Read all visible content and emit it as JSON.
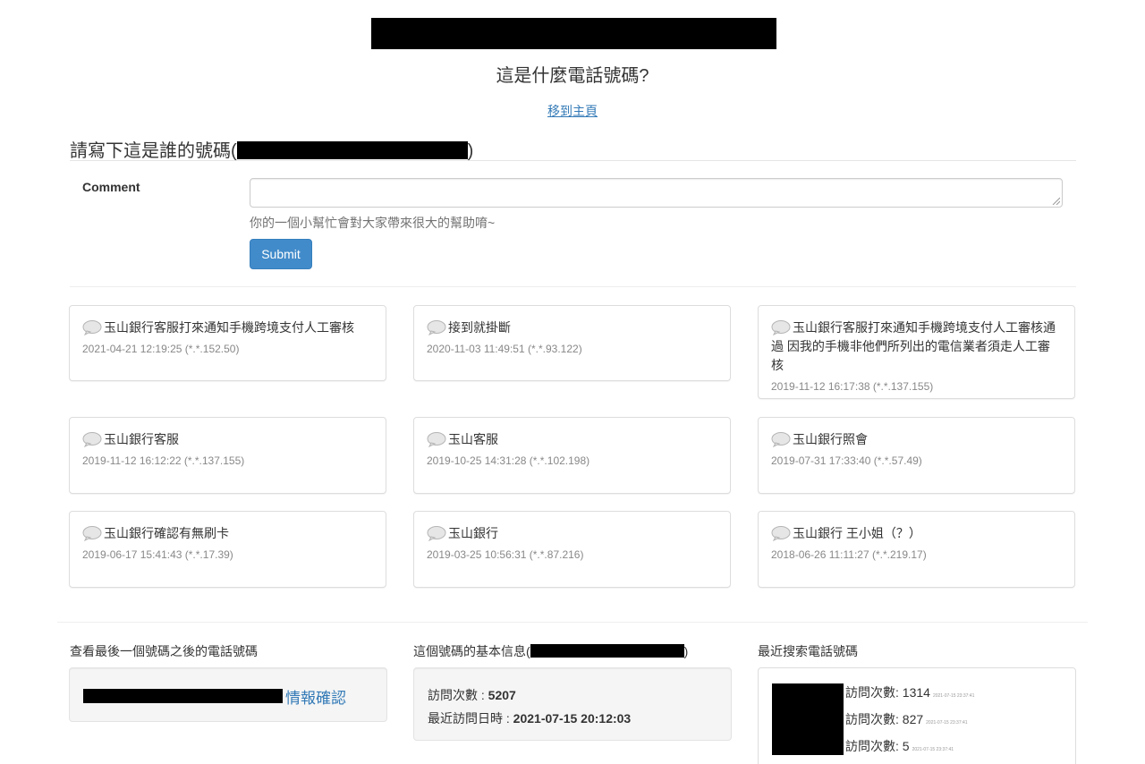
{
  "header": {
    "title": "這是什麼電話號碼?",
    "home_link": "移到主頁"
  },
  "form": {
    "heading_prefix": "請寫下這是誰的號碼(",
    "heading_suffix": ")",
    "comment_label": "Comment",
    "comment_value": "",
    "help_text": "你的一個小幫忙會對大家帶來很大的幫助唷~",
    "submit_label": "Submit"
  },
  "comments": [
    {
      "text": "玉山銀行客服打來通知手機跨境支付人工審核",
      "meta": "2021-04-21 12:19:25 (*.*.152.50)"
    },
    {
      "text": "接到就掛斷",
      "meta": "2020-11-03 11:49:51 (*.*.93.122)"
    },
    {
      "text": "玉山銀行客服打來通知手機跨境支付人工審核通過 因我的手機非他們所列出的電信業者須走人工審核",
      "meta": "2019-11-12 16:17:38 (*.*.137.155)"
    },
    {
      "text": "玉山銀行客服",
      "meta": "2019-11-12 16:12:22 (*.*.137.155)"
    },
    {
      "text": "玉山客服",
      "meta": "2019-10-25 14:31:28 (*.*.102.198)"
    },
    {
      "text": "玉山銀行照會",
      "meta": "2019-07-31 17:33:40 (*.*.57.49)"
    },
    {
      "text": "玉山銀行確認有無刷卡",
      "meta": "2019-06-17 15:41:43 (*.*.17.39)"
    },
    {
      "text": "玉山銀行",
      "meta": "2019-03-25 10:56:31 (*.*.87.216)"
    },
    {
      "text": "玉山銀行 王小姐（？）",
      "meta": "2018-06-26 11:11:27 (*.*.219.17)"
    }
  ],
  "next_number": {
    "title": "查看最後一個號碼之後的電話號碼",
    "link": "情報確認"
  },
  "basic_info": {
    "title_prefix": "這個號碼的基本信息(",
    "title_suffix": ")",
    "visits_label": "訪問次數 : ",
    "visits_value": "5207",
    "last_visit_label": "最近訪問日時 : ",
    "last_visit_value": "2021-07-15 20:12:03"
  },
  "recent_searches": {
    "title": "最近搜索電話號碼",
    "rows": [
      {
        "label": "訪問次數:",
        "count": "1314",
        "ts": "2021-07-15 23:37:41"
      },
      {
        "label": "訪問次數:",
        "count": "827",
        "ts": "2021-07-15 23:37:41"
      },
      {
        "label": "訪問次數:",
        "count": "5",
        "ts": "2021-07-15 23:37:41"
      }
    ]
  },
  "colors": {
    "link": "#337ab7",
    "button": "#428bca",
    "meta_text": "#888888"
  }
}
